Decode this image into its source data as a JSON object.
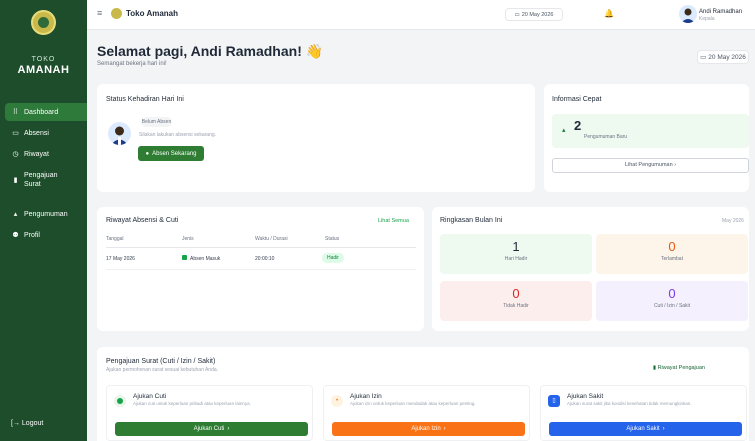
{
  "sidebar": {
    "brand_line1": "TOKO",
    "brand_line2": "AMANAH",
    "items": [
      {
        "label": "Dashboard"
      },
      {
        "label": "Absensi"
      },
      {
        "label": "Riwayat"
      },
      {
        "label": "Pengajuan Surat"
      },
      {
        "label": "Pengumuman"
      },
      {
        "label": "Profil"
      }
    ],
    "logout": "Logout"
  },
  "header": {
    "title": "Toko Amanah",
    "date": "20 May 2026",
    "user_name": "Andi Ramadhan",
    "user_role": "Kepala"
  },
  "greeting": {
    "title": "Selamat pagi, Andi Ramadhan! 👋",
    "subtitle": "Semangat bekerja hari ini!",
    "date": "20 May 2026"
  },
  "attendance": {
    "title": "Status Kehadiran Hari Ini",
    "badge": "Belum Absen",
    "hint": "Silakan lakukan absensi sekarang.",
    "button": "Absen Sekarang"
  },
  "quick_info": {
    "title": "Informasi Cepat",
    "count": "2",
    "label": "Pengumuman Baru",
    "button": "Lihat Pengumuman"
  },
  "history": {
    "title": "Riwayat Absensi & Cuti",
    "link": "Lihat Semua",
    "headers": [
      "Tanggal",
      "Jenis",
      "Waktu / Durasi",
      "Status"
    ],
    "row": {
      "date": "17 May 2026",
      "type": "Absen Masuk",
      "time": "20:00:10",
      "status": "Hadir"
    }
  },
  "summary": {
    "title": "Ringkasan Bulan Ini",
    "month": "May 2026",
    "stats": [
      {
        "value": "1",
        "label": "Hari Hadir"
      },
      {
        "value": "0",
        "label": "Terlambat"
      },
      {
        "value": "0",
        "label": "Tidak Hadir"
      },
      {
        "value": "0",
        "label": "Cuti / Izin / Sakit"
      }
    ]
  },
  "requests": {
    "title": "Pengajuan Surat (Cuti / Izin / Sakit)",
    "subtitle": "Ajukan permohonan surat sesuai kebutuhan Anda.",
    "history_link": "Riwayat Pengajuan",
    "items": [
      {
        "title": "Ajukan Cuti",
        "desc": "Ajukan cuti untuk keperluan pribadi atau keperluan lainnya.",
        "button": "Ajukan Cuti"
      },
      {
        "title": "Ajukan Izin",
        "desc": "Ajukan izin untuk keperluan mendadak atau keperluan penting.",
        "button": "Ajukan Izin"
      },
      {
        "title": "Ajukan Sakit",
        "desc": "Ajukan surat sakit jika kondisi kesehatan tidak memungkinkan.",
        "button": "Ajukan Sakit"
      }
    ]
  }
}
